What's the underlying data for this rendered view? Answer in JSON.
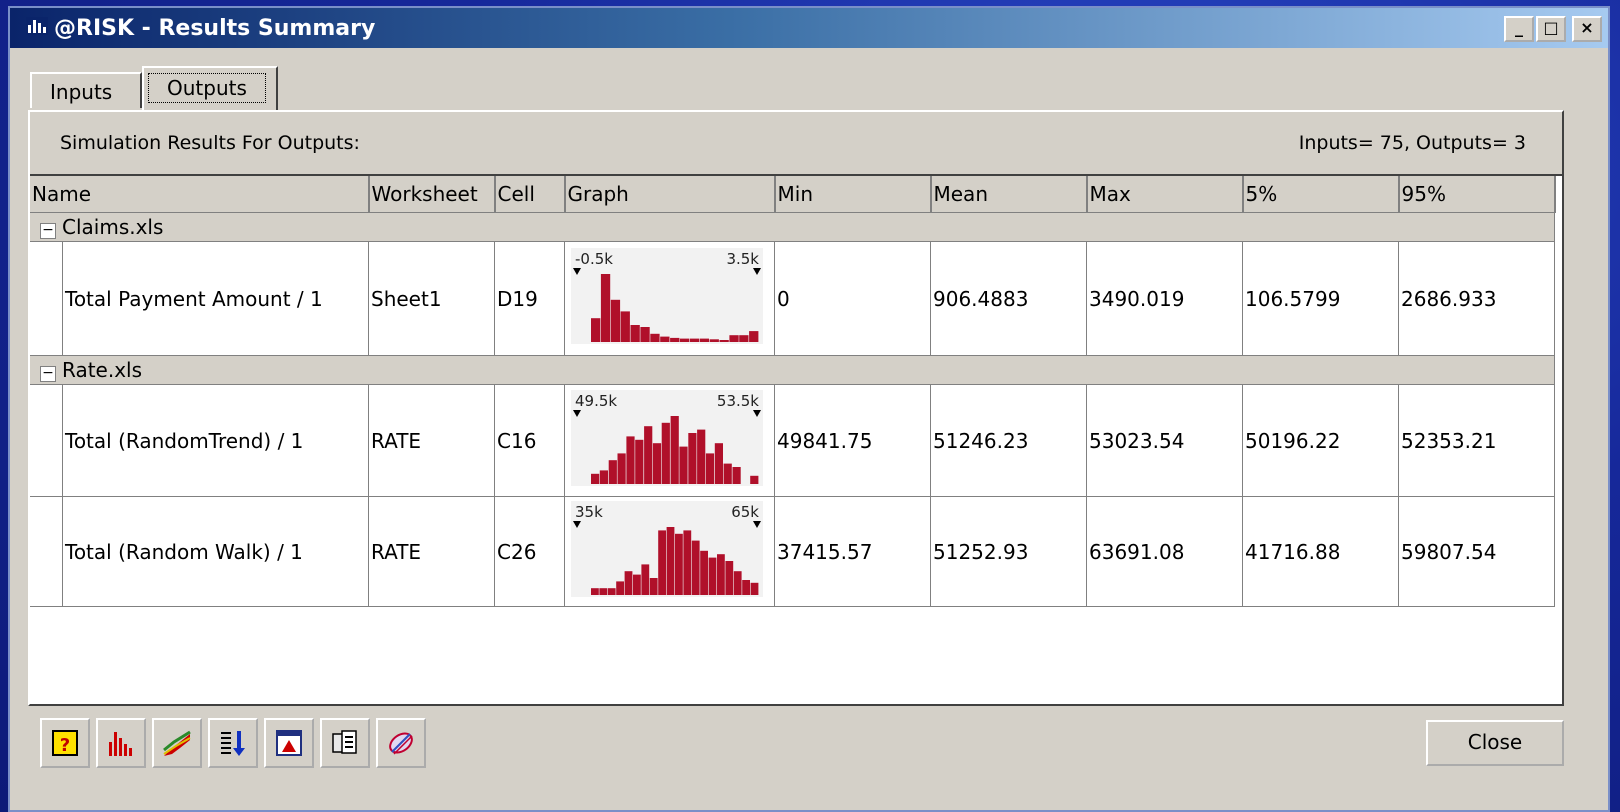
{
  "window": {
    "title": "@RISK - Results Summary",
    "controls": [
      "_",
      "□",
      "×"
    ]
  },
  "tabs": [
    {
      "label": "Inputs",
      "active": false
    },
    {
      "label": "Outputs",
      "active": true
    }
  ],
  "summary": {
    "heading": "Simulation Results For Outputs:",
    "counts": "Inputs= 75, Outputs= 3"
  },
  "columns": [
    "Name",
    "Worksheet",
    "Cell",
    "Graph",
    "Min",
    "Mean",
    "Max",
    "5%",
    "95%"
  ],
  "groups": [
    {
      "file": "Claims.xls",
      "expander": "−",
      "rows": [
        {
          "name": "Total Payment Amount / 1",
          "worksheet": "Sheet1",
          "cell": "D19",
          "graph": {
            "left": "-0.5k",
            "right": "3.5k",
            "bars": [
              0.35,
              1.0,
              0.62,
              0.45,
              0.25,
              0.22,
              0.12,
              0.08,
              0.06,
              0.05,
              0.05,
              0.05,
              0.04,
              0.03,
              0.1,
              0.1,
              0.16
            ]
          },
          "min": "0",
          "mean": "906.4883",
          "max": "3490.019",
          "p5": "106.5799",
          "p95": "2686.933"
        }
      ]
    },
    {
      "file": "Rate.xls",
      "expander": "−",
      "rows": [
        {
          "name": "Total (RandomTrend) / 1",
          "worksheet": "RATE",
          "cell": "C16",
          "graph": {
            "left": "49.5k",
            "right": "53.5k",
            "bars": [
              0.15,
              0.2,
              0.35,
              0.45,
              0.7,
              0.65,
              0.85,
              0.6,
              0.9,
              1.0,
              0.55,
              0.75,
              0.8,
              0.45,
              0.6,
              0.3,
              0.25,
              0.0,
              0.12
            ]
          },
          "min": "49841.75",
          "mean": "51246.23",
          "max": "53023.54",
          "p5": "50196.22",
          "p95": "52353.21"
        },
        {
          "name": "Total (Random Walk) / 1",
          "worksheet": "RATE",
          "cell": "C26",
          "graph": {
            "left": "35k",
            "right": "65k",
            "bars": [
              0.1,
              0.1,
              0.1,
              0.2,
              0.35,
              0.3,
              0.45,
              0.25,
              0.95,
              1.0,
              0.9,
              0.95,
              0.8,
              0.65,
              0.55,
              0.6,
              0.5,
              0.35,
              0.22,
              0.18
            ]
          },
          "min": "37415.57",
          "mean": "51252.93",
          "max": "63691.08",
          "p5": "41716.88",
          "p95": "59807.54"
        }
      ]
    }
  ],
  "scrollbar": {
    "left_arrow": "◀",
    "right_arrow": "▶"
  },
  "toolbar": {
    "buttons": [
      {
        "name": "help-icon"
      },
      {
        "name": "histogram-icon"
      },
      {
        "name": "cumulative-graph-icon"
      },
      {
        "name": "sort-icon"
      },
      {
        "name": "report-icon"
      },
      {
        "name": "copy-icon"
      },
      {
        "name": "tornado-icon"
      }
    ]
  },
  "close_label": "Close",
  "colors": {
    "bar": "#b0102a",
    "title_start": "#0a246a",
    "title_end": "#a6caf0",
    "face": "#d4d0c8"
  }
}
